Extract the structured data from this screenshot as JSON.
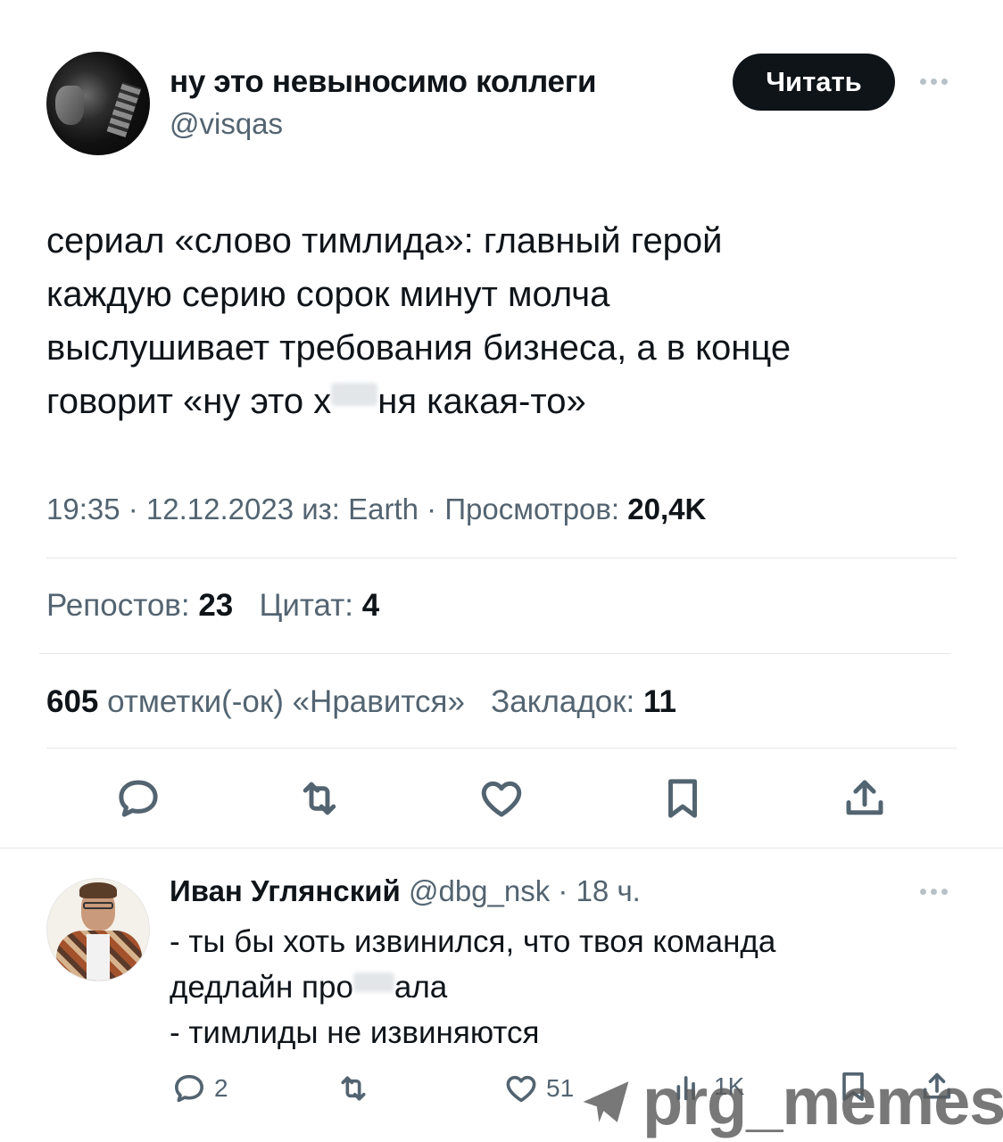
{
  "tweet": {
    "author_name": "ну это невыносимо коллеги",
    "author_handle": "@visqas",
    "follow_label": "Читать",
    "text_part1": "сериал «слово тимлида»: главный герой\nкаждую серию сорок минут молча\nвыслушивает требования бизнеса, а в конце\nговорит «ну это х",
    "text_part2": "ня какая-то»",
    "meta_time": "19:35 · 12.12.2023 из: Earth · Просмотров: ",
    "meta_views": "20,4K",
    "reposts_label": "Репостов: ",
    "reposts_count": "23",
    "quotes_label": "Цитат: ",
    "quotes_count": "4",
    "likes_count": "605",
    "likes_label": " отметки(-ок) «Нравится»",
    "bookmarks_label": "Закладок: ",
    "bookmarks_count": "11"
  },
  "reply": {
    "author_name": "Иван Углянский",
    "meta": " @dbg_nsk · 18 ч.",
    "text_part1": "- ты бы хоть извинился, что твоя команда\nдедлайн про",
    "text_part2": "ала\n- тимлиды не извиняются",
    "reply_count": "2",
    "like_count": "51",
    "views_count": "1K"
  },
  "icons": {
    "reply": "comment-icon",
    "repost": "repost-icon",
    "like": "heart-icon",
    "bookmark": "bookmark-icon",
    "share": "share-icon",
    "views": "bar-chart-icon"
  },
  "watermark": {
    "text": "prg_memes"
  }
}
